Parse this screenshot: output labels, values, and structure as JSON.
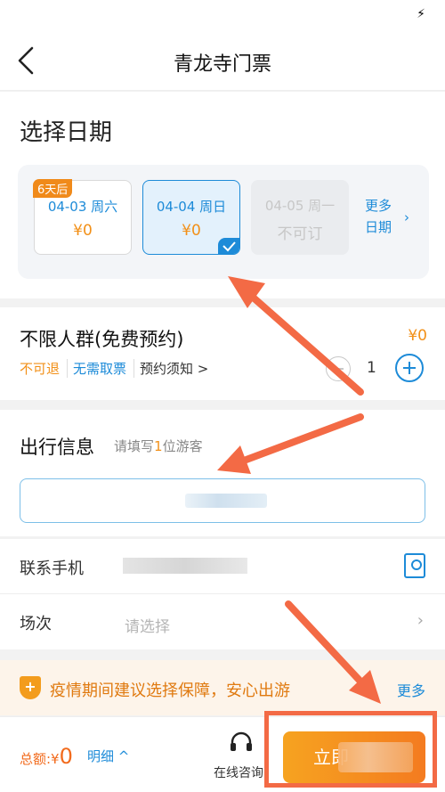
{
  "status_bar": {
    "icon": "charging-bolt-icon",
    "bolt": "⚡"
  },
  "nav": {
    "title": "青龙寺门票",
    "back_icon": "back-chevron-icon"
  },
  "date_section": {
    "heading": "选择日期",
    "cards": [
      {
        "badge": "6天后",
        "date": "04-03 周六",
        "price": "¥0",
        "state": "available"
      },
      {
        "badge": "",
        "date": "04-04 周日",
        "price": "¥0",
        "state": "selected"
      },
      {
        "badge": "",
        "date": "04-05 周一",
        "price": "不可订",
        "state": "unavailable"
      }
    ],
    "more_line1": "更多",
    "more_line2": "日期",
    "chevron": "›"
  },
  "ticket": {
    "name": "不限人群(免费预约)",
    "price": "¥0",
    "tags": [
      "不可退",
      "无需取票",
      "预约须知 >"
    ],
    "quantity": "1"
  },
  "traveler": {
    "heading": "出行信息",
    "hint_prefix": "请填写",
    "hint_count": "1",
    "hint_suffix": "位游客"
  },
  "contact": {
    "phone_label": "联系手机",
    "session_label": "场次",
    "session_placeholder": "请选择",
    "arrow": "›"
  },
  "banner": {
    "icon_glyph": "+",
    "text": "疫情期间建议选择保障，安心出游",
    "more": "更多"
  },
  "bottom_bar": {
    "total_label": "总额:¥",
    "total_amount": "0",
    "detail": "明细 ^",
    "online_consult": "在线咨询",
    "book_partial": "立即"
  },
  "colors": {
    "accent_blue": "#1d8bd8",
    "price_orange": "#f29018",
    "annotation": "#f36a45"
  }
}
